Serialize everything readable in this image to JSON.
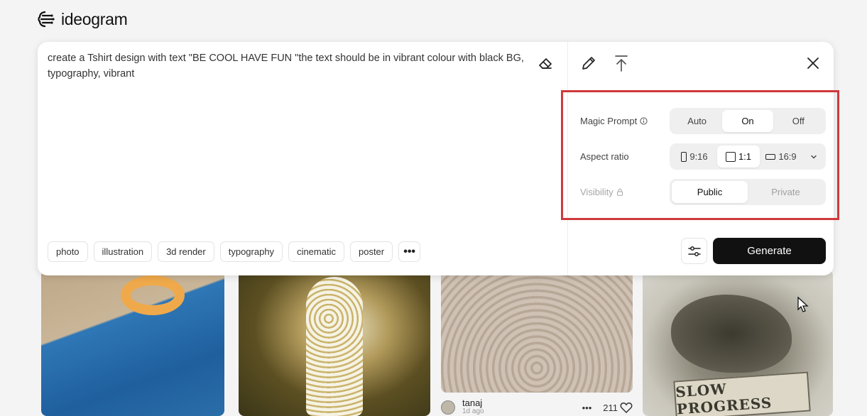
{
  "header": {
    "logo_text": "ideogram",
    "logo_icon": "brain-logo-icon"
  },
  "prompt": {
    "text": "create a Tshirt design with text \"BE COOL HAVE FUN \"the text should be in vibrant colour with black BG, typography, vibrant",
    "erase_icon": "eraser-icon"
  },
  "toolbar": {
    "edit_icon": "pencil-icon",
    "upload_icon": "upload-icon",
    "close_icon": "close-icon"
  },
  "style_tags": [
    "photo",
    "illustration",
    "3d render",
    "typography",
    "cinematic",
    "poster"
  ],
  "more_label": "•••",
  "settings": {
    "magic_prompt": {
      "label": "Magic Prompt",
      "options": [
        "Auto",
        "On",
        "Off"
      ],
      "selected": "On"
    },
    "aspect_ratio": {
      "label": "Aspect ratio",
      "options": [
        "9:16",
        "1:1",
        "16:9"
      ],
      "selected": "1:1"
    },
    "visibility": {
      "label": "Visibility",
      "options": [
        "Public",
        "Private"
      ],
      "selected": "Public"
    }
  },
  "actions": {
    "settings_icon": "sliders-icon",
    "generate_label": "Generate"
  },
  "gallery": {
    "banner_text": "SLOW PROGRESS",
    "card3_user": "tanaj",
    "card3_time": "1d ago",
    "card3_more": "•••",
    "card3_likes": "211"
  },
  "colors": {
    "accent_frame": "#d0393c",
    "generate_bg": "#111111"
  }
}
